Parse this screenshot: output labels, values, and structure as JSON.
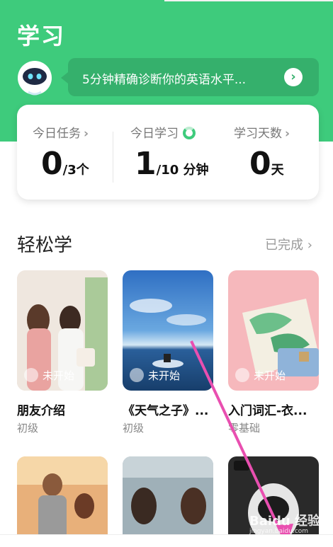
{
  "header": {
    "title": "学习",
    "bubble_text": "5分钟精确诊断你的英语水平...",
    "bubble_arrow": "›",
    "bg_color": "#3ecb7c"
  },
  "stats": [
    {
      "label": "今日任务",
      "big": "0",
      "small": "/3个",
      "icon": "chevron-right-icon"
    },
    {
      "label": "今日学习",
      "big": "1",
      "small": "/10 分钟",
      "icon": "progress-ring-icon"
    },
    {
      "label": "学习天数",
      "big": "0",
      "small": "天",
      "icon": "chevron-right-icon"
    }
  ],
  "section": {
    "title": "轻松学",
    "link": "已完成 ›"
  },
  "cards": [
    {
      "title": "朋友介绍",
      "level": "初级",
      "badge": "未开始"
    },
    {
      "title": "《天气之子》...",
      "level": "初级",
      "badge": "未开始"
    },
    {
      "title": "入门词汇-衣...",
      "level": "零基础",
      "badge": "未开始"
    }
  ],
  "watermark": {
    "brand": "Baidu 经验",
    "url": "jingyan.baidu.com"
  }
}
